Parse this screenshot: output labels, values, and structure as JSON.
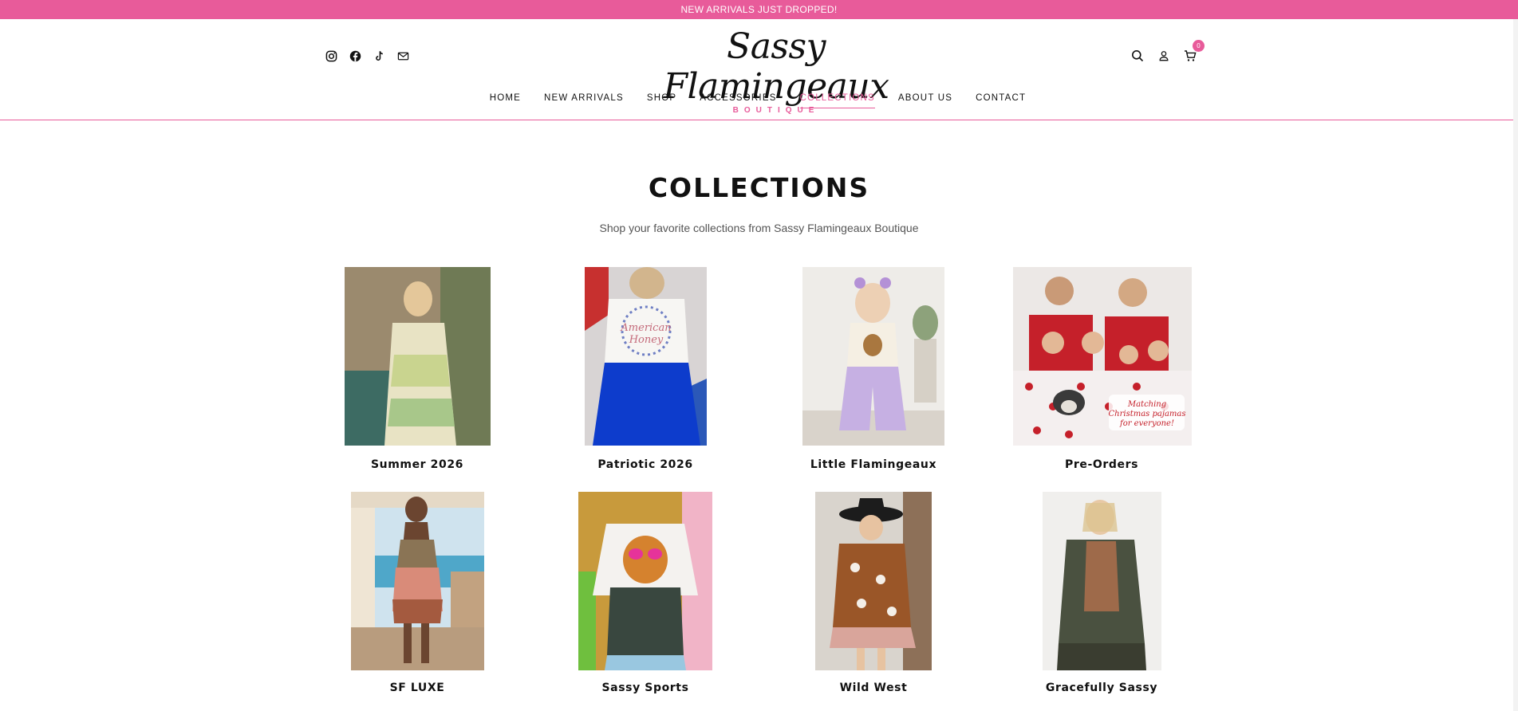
{
  "announcement": "NEW ARRIVALS JUST DROPPED!",
  "brand": {
    "name": "Sassy Flamingeaux",
    "sub": "BOUTIQUE",
    "accent": "#e85b9a"
  },
  "social": [
    "instagram-icon",
    "facebook-icon",
    "tiktok-icon",
    "mail-icon"
  ],
  "nav": [
    {
      "label": "HOME",
      "active": false
    },
    {
      "label": "NEW ARRIVALS",
      "active": false
    },
    {
      "label": "SHOP",
      "active": false
    },
    {
      "label": "ACCESSORIES",
      "active": false
    },
    {
      "label": "COLLECTIONS",
      "active": true
    },
    {
      "label": "ABOUT US",
      "active": false
    },
    {
      "label": "CONTACT",
      "active": false
    }
  ],
  "cart": {
    "count": "0"
  },
  "page": {
    "title": "COLLECTIONS",
    "subtitle": "Shop your favorite collections from Sassy Flamingeaux Boutique"
  },
  "collections": [
    {
      "name": "Summer 2026"
    },
    {
      "name": "Patriotic 2026"
    },
    {
      "name": "Little Flamingeaux"
    },
    {
      "name": "Pre-Orders"
    },
    {
      "name": "SF LUXE"
    },
    {
      "name": "Sassy Sports"
    },
    {
      "name": "Wild West"
    },
    {
      "name": "Gracefully Sassy"
    }
  ]
}
